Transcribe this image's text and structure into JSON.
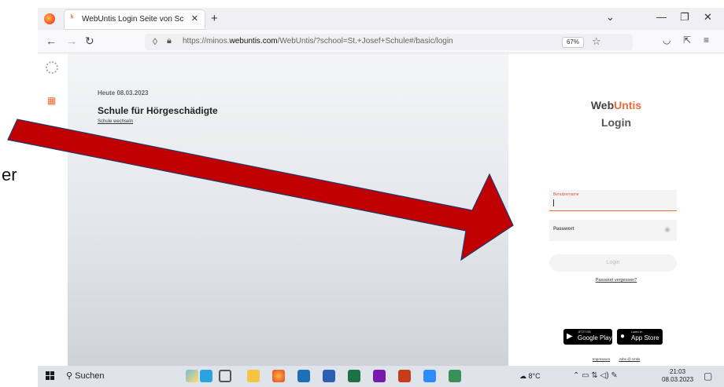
{
  "slide": {
    "left_fragment": "er"
  },
  "browser": {
    "tab": {
      "title": "WebUntis Login Seite von Schule"
    },
    "url": {
      "prefix": "https://minos.",
      "domain": "webuntis.com",
      "suffix": "/WebUntis/?school=St.+Josef+Schule#/basic/login"
    },
    "zoom": "67%"
  },
  "page": {
    "date": "Heute 08.03.2023",
    "school": "Schule für Hörgeschädigte",
    "change_school": "Schule wechseln",
    "brand": {
      "web": "Web",
      "untis": "Untis",
      "sub": "Login"
    },
    "username_label": "Benutzername",
    "password_label": "Passwort",
    "login_button": "Login",
    "forgot": "Passwort vergessen?",
    "google": {
      "small": "JETZT BEI",
      "big": "Google Play"
    },
    "apple": {
      "small": "Laden im",
      "big": "App Store"
    },
    "footer": {
      "imprint": "Impressum",
      "untis": "Jobs @ Untis"
    }
  },
  "taskbar": {
    "search": "Suchen",
    "weather": "8°C",
    "time": "21:03",
    "date": "08.03.2023"
  },
  "colors": {
    "accent": "#f26b3a",
    "arrow_fill": "#c00000",
    "arrow_stroke": "#1f3a6e"
  }
}
